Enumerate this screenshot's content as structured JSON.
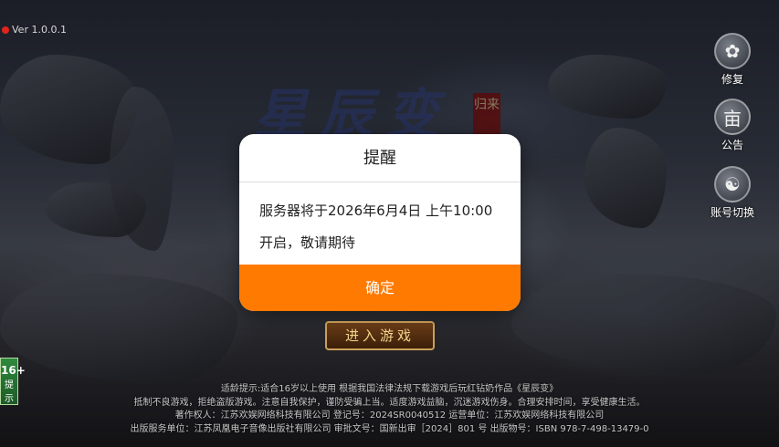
{
  "version": "Ver 1.0.0.1",
  "title_art": "星辰变",
  "title_seal": "归来",
  "side_buttons": [
    {
      "icon": "repair-icon",
      "glyph": "✿",
      "label": "修复"
    },
    {
      "icon": "notice-icon",
      "glyph": "亩",
      "label": "公告"
    },
    {
      "icon": "switch-account-icon",
      "glyph": "☯",
      "label": "账号切换"
    }
  ],
  "enter_button": "进入游戏",
  "age_rating": {
    "num": "16+",
    "label": "提示"
  },
  "footer_lines": [
    "适龄提示:适合16岁以上使用 根据我国法律法规下载游戏后玩红钻奶作品《星辰变》",
    "抵制不良游戏，拒绝盗版游戏。注意自我保护，谨防受骗上当。适度游戏益脑，沉迷游戏伤身。合理安排时间，享受健康生活。",
    "著作权人：江苏欢娱网络科技有限公司 登记号：2024SR0040512 运营单位：江苏欢娱网络科技有限公司",
    "出版服务单位：江苏凤凰电子音像出版社有限公司 审批文号：国新出审［2024］801 号 出版物号：ISBN 978-7-498-13479-0"
  ],
  "dialog": {
    "title": "提醒",
    "message": "服务器将于2026年6月4日 上午10:00开启，敬请期待",
    "ok": "确定"
  },
  "colors": {
    "accent": "#ff7a00",
    "version_dot": "#e0241e"
  }
}
